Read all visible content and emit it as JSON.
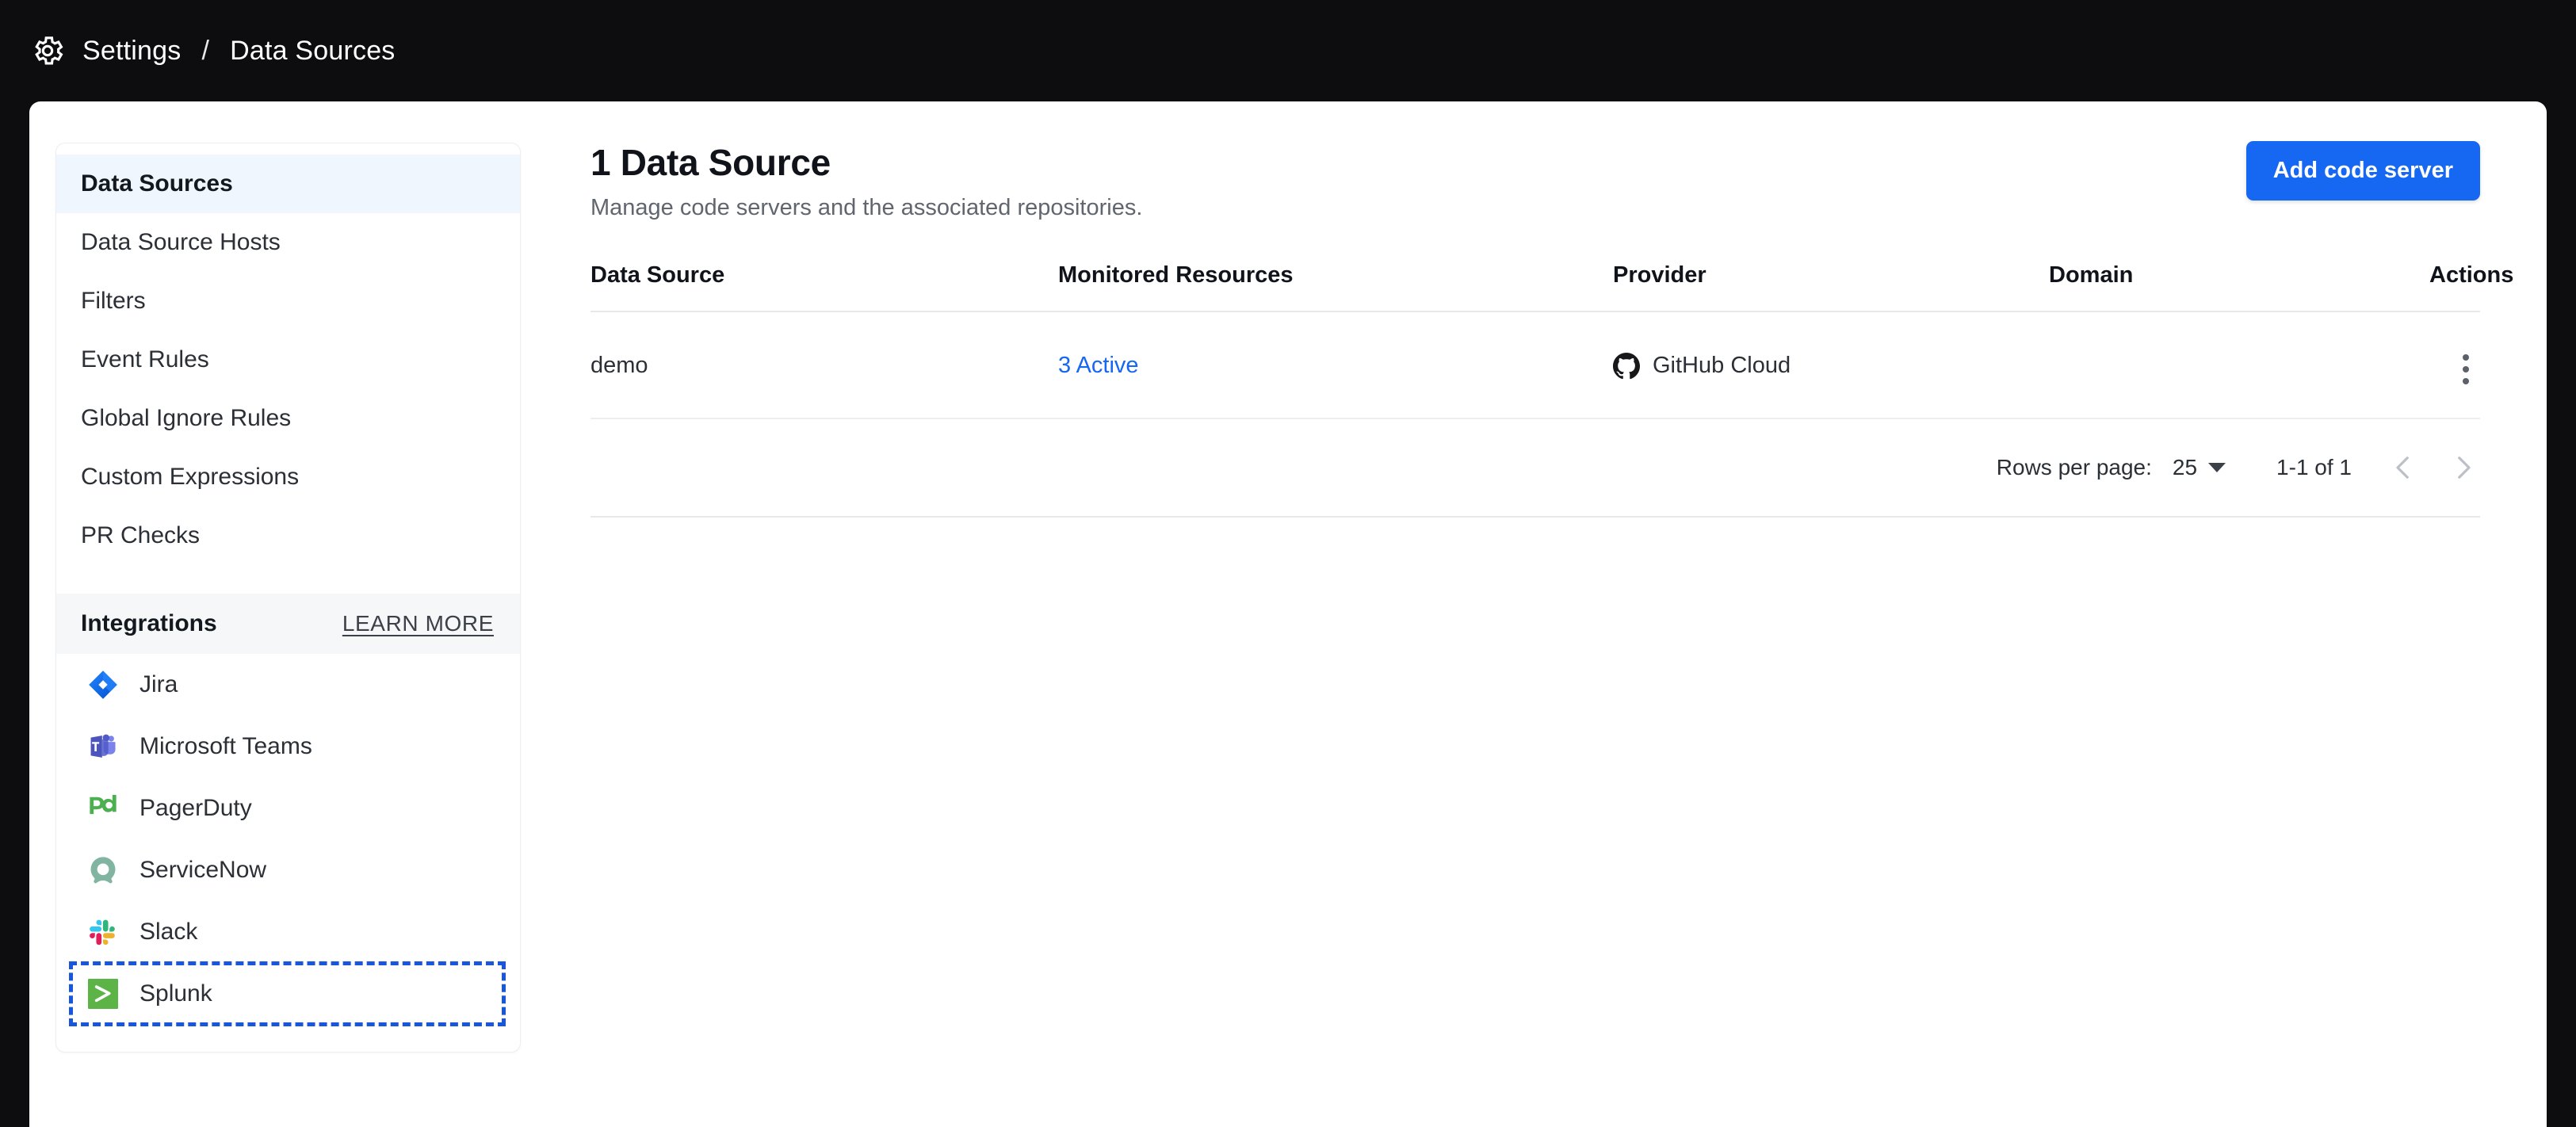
{
  "breadcrumb": {
    "icon": "gear-icon",
    "root": "Settings",
    "separator": "/",
    "current": "Data Sources"
  },
  "sidebar": {
    "items": [
      {
        "label": "Data Sources",
        "active": true
      },
      {
        "label": "Data Source Hosts",
        "active": false
      },
      {
        "label": "Filters",
        "active": false
      },
      {
        "label": "Event Rules",
        "active": false
      },
      {
        "label": "Global Ignore Rules",
        "active": false
      },
      {
        "label": "Custom Expressions",
        "active": false
      },
      {
        "label": "PR Checks",
        "active": false
      }
    ],
    "integrations": {
      "title": "Integrations",
      "learn_more": "LEARN MORE",
      "items": [
        {
          "label": "Jira",
          "icon": "jira-icon",
          "highlighted": false
        },
        {
          "label": "Microsoft Teams",
          "icon": "microsoft-teams-icon",
          "highlighted": false
        },
        {
          "label": "PagerDuty",
          "icon": "pagerduty-icon",
          "highlighted": false
        },
        {
          "label": "ServiceNow",
          "icon": "servicenow-icon",
          "highlighted": false
        },
        {
          "label": "Slack",
          "icon": "slack-icon",
          "highlighted": false
        },
        {
          "label": "Splunk",
          "icon": "splunk-icon",
          "highlighted": true
        }
      ]
    }
  },
  "main": {
    "title": "1 Data Source",
    "subtitle": "Manage code servers and the associated repositories.",
    "add_button": "Add code server",
    "table": {
      "columns": [
        "Data Source",
        "Monitored Resources",
        "Provider",
        "Domain",
        "Actions"
      ],
      "rows": [
        {
          "data_source": "demo",
          "monitored_resources": "3 Active",
          "provider": "GitHub Cloud",
          "provider_icon": "github-icon",
          "domain": "",
          "actions_icon": "kebab-menu-icon"
        }
      ]
    },
    "pagination": {
      "rows_per_page_label": "Rows per page:",
      "rows_per_page_value": "25",
      "range": "1-1 of 1",
      "prev_icon": "chevron-left-icon",
      "next_icon": "chevron-right-icon"
    }
  },
  "colors": {
    "page_background": "#0d0d0f",
    "accent_blue": "#1667f2",
    "active_nav_background": "#eff6fe",
    "highlight_outline": "#1a56db",
    "splunk_green": "#5cb346"
  }
}
